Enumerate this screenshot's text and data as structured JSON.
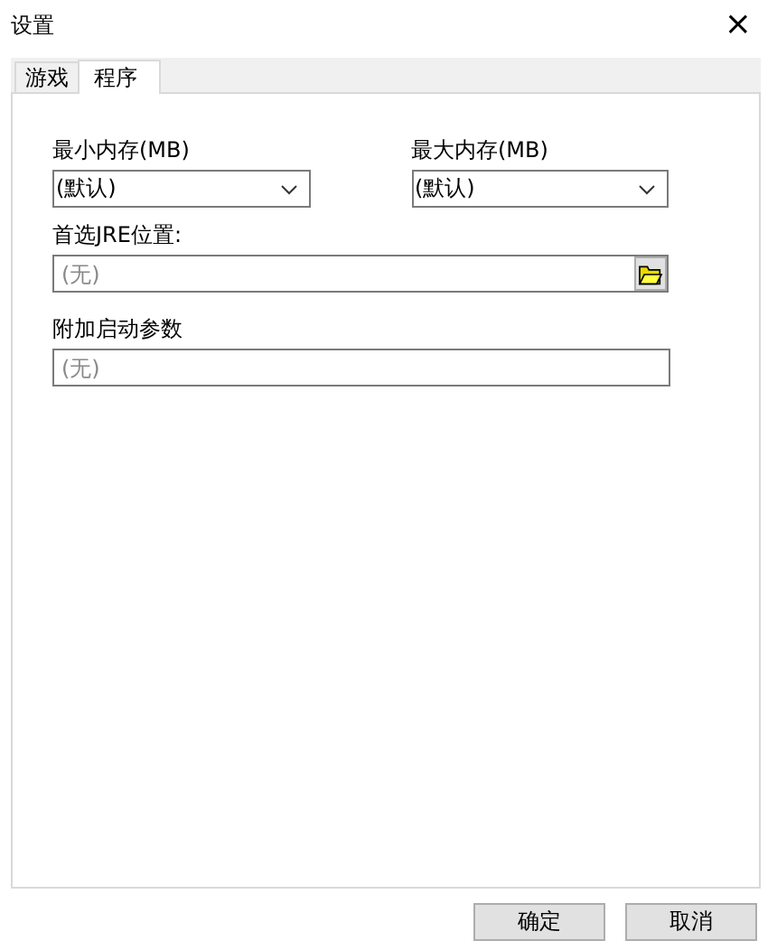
{
  "window": {
    "title": "设置",
    "close": "×"
  },
  "tabs": [
    {
      "label": "游戏",
      "selected": false
    },
    {
      "label": "程序",
      "selected": true
    }
  ],
  "memory": [
    {
      "label": "最小内存(MB)",
      "value": "(默认)"
    },
    {
      "label": "最大内存(MB)",
      "value": "(默认)"
    }
  ],
  "jre": {
    "label": "首选JRE位置:",
    "placeholder": "(无)"
  },
  "args": {
    "label": "附加启动参数",
    "placeholder": "(无)"
  },
  "buttons": [
    "确定",
    "取消"
  ]
}
